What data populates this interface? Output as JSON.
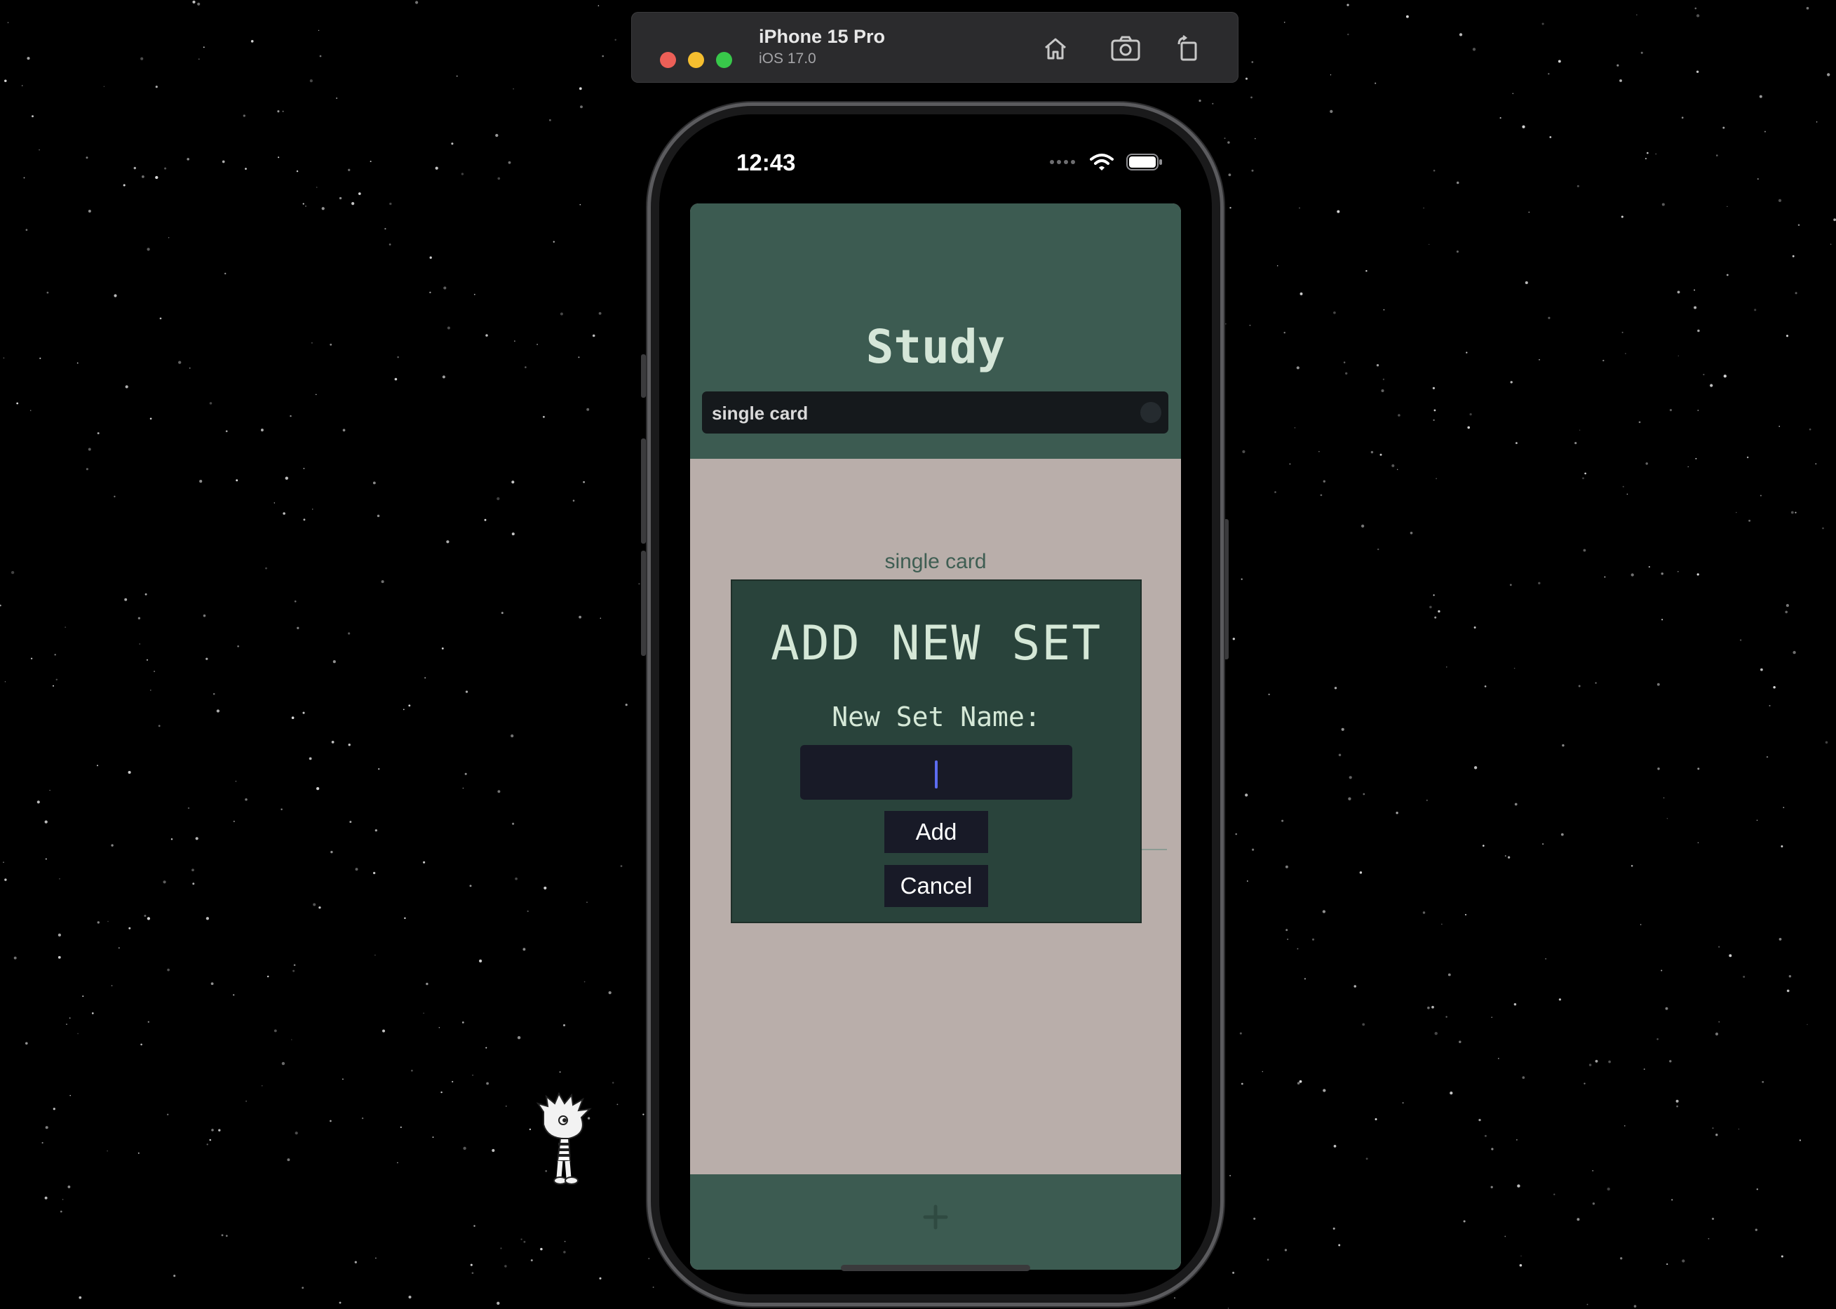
{
  "simulator": {
    "device_name": "iPhone 15 Pro",
    "os_version": "iOS 17.0",
    "traffic_lights": [
      "#ec5f57",
      "#f5be2f",
      "#38c84a"
    ],
    "toolbar_icons": [
      "home-icon",
      "screenshot-camera-icon",
      "rotate-icon"
    ]
  },
  "status_bar": {
    "time": "12:43",
    "icons": [
      "signal-dots-icon",
      "wifi-icon",
      "battery-icon"
    ]
  },
  "app": {
    "title": "Study",
    "search": {
      "value": "single card"
    },
    "set_list": [
      "single card"
    ],
    "bottom_bar": {
      "icon": "plus-icon"
    },
    "colors": {
      "header": "#3c5b51",
      "background": "#b9aeaa",
      "modal": "#29433b",
      "text_accent": "#d5e6d8"
    }
  },
  "modal": {
    "title": "ADD NEW SET",
    "field_label": "New Set Name:",
    "input_value": "",
    "add_label": "Add",
    "cancel_label": "Cancel"
  }
}
